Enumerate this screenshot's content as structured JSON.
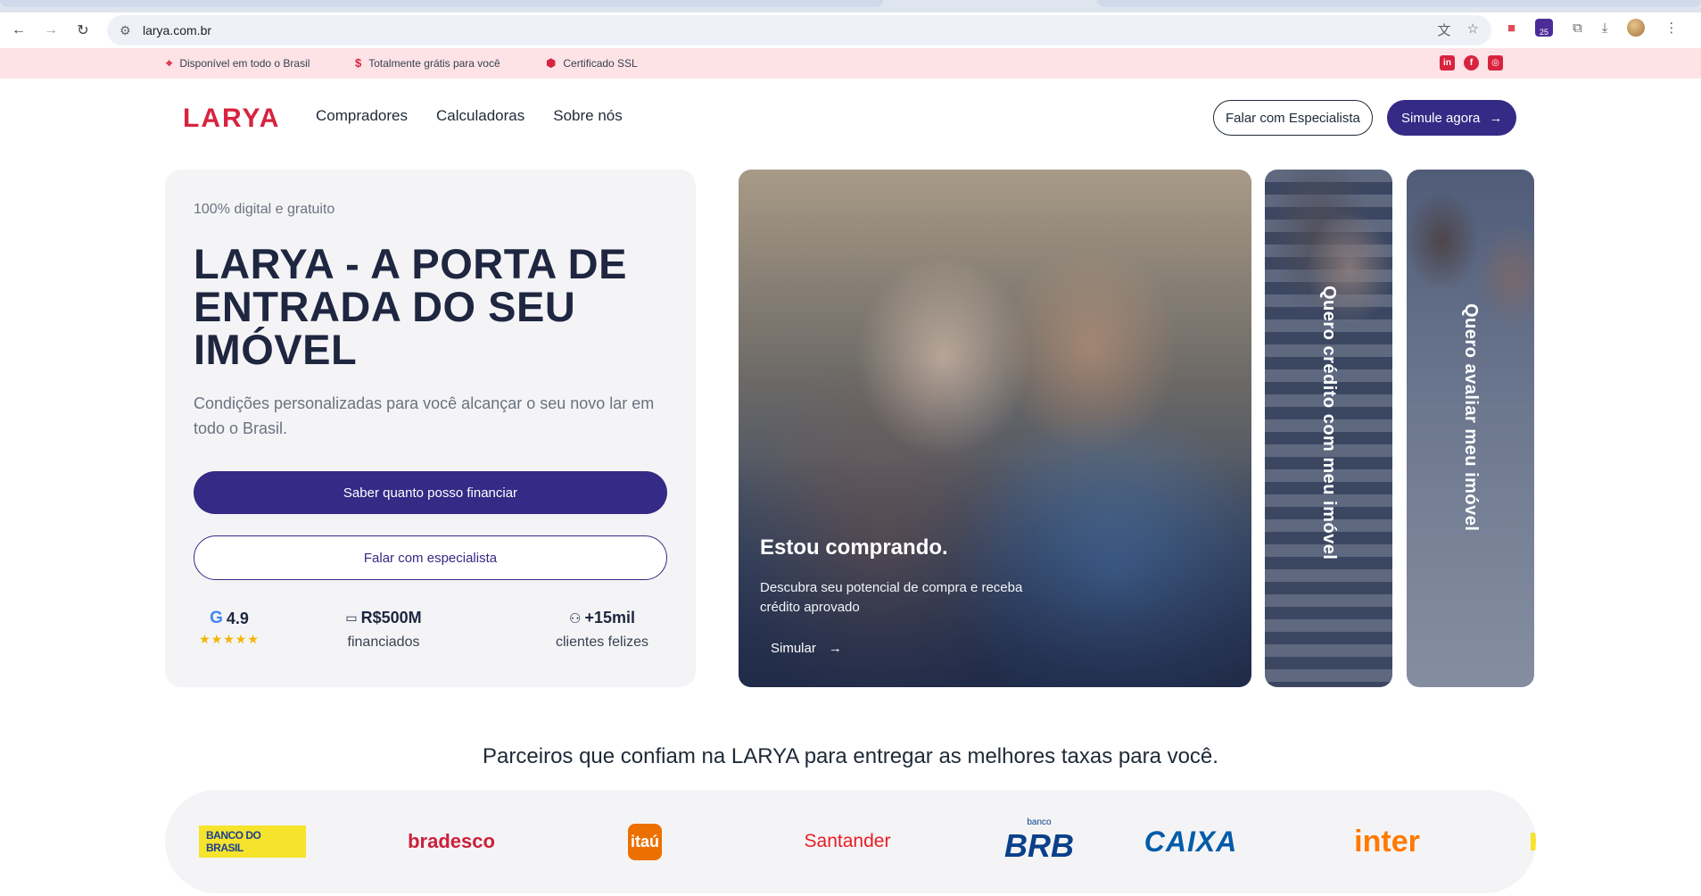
{
  "browser": {
    "url": "larya.com.br",
    "extension_badge_count": "25"
  },
  "infobar": {
    "items": [
      {
        "icon": "location-pin-icon",
        "label": "Disponível em todo o Brasil"
      },
      {
        "icon": "dollar-icon",
        "label": "Totalmente grátis para você"
      },
      {
        "icon": "shield-icon",
        "label": "Certificado SSL"
      }
    ],
    "social": [
      "linkedin-icon",
      "facebook-icon",
      "instagram-icon"
    ]
  },
  "header": {
    "logo": "LARYA",
    "nav": [
      "Compradores",
      "Calculadoras",
      "Sobre nós"
    ],
    "cta_outline": "Falar com Especialista",
    "cta_solid": "Simule agora"
  },
  "hero": {
    "eyebrow": "100% digital e gratuito",
    "title": "LARYA - A PORTA DE ENTRADA DO SEU IMÓVEL",
    "subtitle": "Condições personalizadas para você alcançar o seu novo lar em todo o Brasil.",
    "primary_button": "Saber quanto posso financiar",
    "secondary_button": "Falar com especialista",
    "stats": [
      {
        "value": "4.9",
        "label": "",
        "stars": 5
      },
      {
        "value": "R$500M",
        "label": "financiados"
      },
      {
        "value": "+15mil",
        "label": "clientes felizes"
      }
    ]
  },
  "cards": {
    "main": {
      "title": "Estou comprando.",
      "description": "Descubra seu potencial de compra e receba crédito aprovado",
      "link": "Simular"
    },
    "side": [
      {
        "label": "Quero crédito com meu imóvel"
      },
      {
        "label": "Quero avaliar meu imóvel"
      }
    ]
  },
  "partners": {
    "title": "Parceiros que confiam na LARYA para entregar as melhores taxas para você.",
    "logos": [
      "BANCO DO BRASIL",
      "bradesco",
      "itaú",
      "Santander",
      "BRB",
      "CAIXA",
      "inter"
    ],
    "brb_prefix": "banco"
  },
  "colors": {
    "brand_red": "#d8233f",
    "brand_indigo": "#352a86",
    "info_bar_bg": "#fde2e6"
  }
}
